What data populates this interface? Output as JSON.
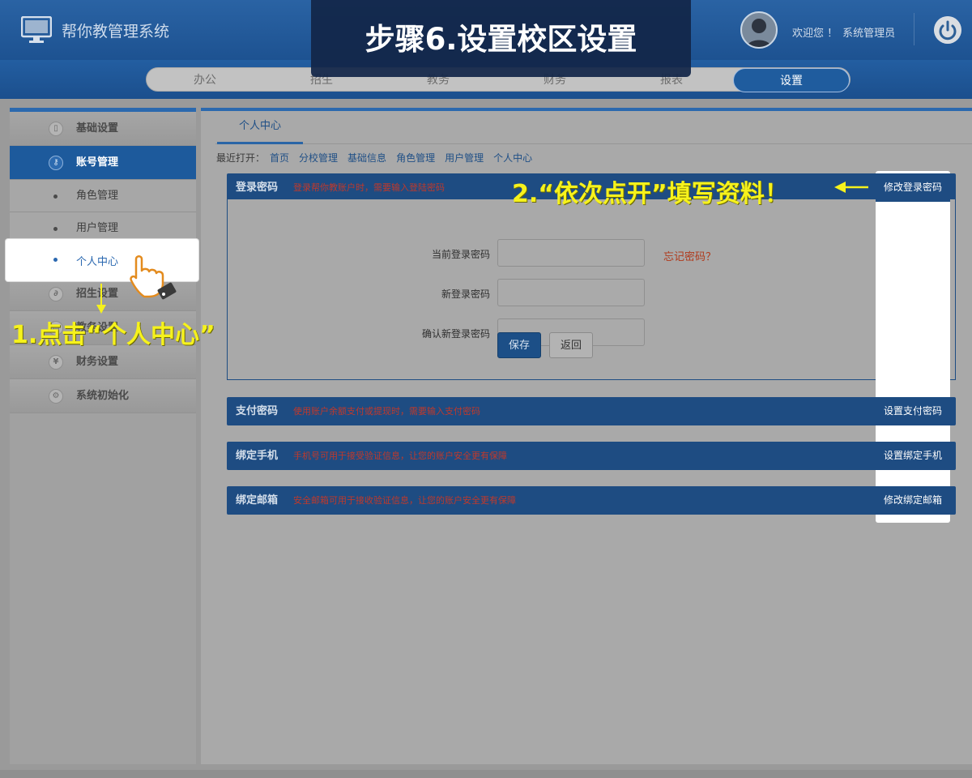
{
  "app": {
    "title": "帮你教管理系统",
    "welcome": "欢迎您 ！",
    "user": "系统管理员"
  },
  "banner": {
    "text": "步骤6.设置校区设置"
  },
  "nav": {
    "items": [
      {
        "label": "办公"
      },
      {
        "label": "招生"
      },
      {
        "label": "教务"
      },
      {
        "label": "财务"
      },
      {
        "label": "报表"
      },
      {
        "label": "设置"
      }
    ],
    "active": "设置"
  },
  "sidebar": {
    "items": [
      {
        "label": "基础设置",
        "icon": "document-icon"
      },
      {
        "label": "账号管理",
        "icon": "key-icon"
      },
      {
        "label": "角色管理"
      },
      {
        "label": "用户管理"
      },
      {
        "label": "个人中心"
      },
      {
        "label": "招生设置",
        "icon": "paperclip-icon"
      },
      {
        "label": "教务设置",
        "icon": "book-icon"
      },
      {
        "label": "财务设置",
        "icon": "yen-icon"
      },
      {
        "label": "系统初始化",
        "icon": "user-settings-icon"
      }
    ]
  },
  "content": {
    "tab": "个人中心",
    "recent_label": "最近打开：",
    "recent": [
      "首页",
      "分校管理",
      "基础信息",
      "角色管理",
      "用户管理",
      "个人中心"
    ]
  },
  "sections": {
    "login": {
      "title": "登录密码",
      "desc": "登录帮你教账户时，需要输入登陆密码",
      "button": "修改登录密码"
    },
    "pay": {
      "title": "支付密码",
      "desc": "使用账户余额支付或提现时，需要输入支付密码",
      "button": "设置支付密码"
    },
    "phone": {
      "title": "绑定手机",
      "desc": "手机号可用于接受验证信息，让您的账户安全更有保障",
      "button": "设置绑定手机"
    },
    "email": {
      "title": "绑定邮箱",
      "desc": "安全邮箱可用于接收验证信息，让您的账户安全更有保障",
      "button": "修改绑定邮箱"
    }
  },
  "form": {
    "current_password_label": "当前登录密码",
    "new_password_label": "新登录密码",
    "confirm_password_label": "确认新登录密码",
    "forgot": "忘记密码？",
    "save": "保存",
    "back": "返回"
  },
  "annotations": {
    "step1": "1.点击“个人中心”",
    "step2": "2.“依次点开”填写资料！"
  },
  "colors": {
    "header_blue": "#2a63a4",
    "section_blue": "#1e4c82",
    "annotation_yellow": "#f6f21c",
    "alert_red": "#c0392b"
  }
}
